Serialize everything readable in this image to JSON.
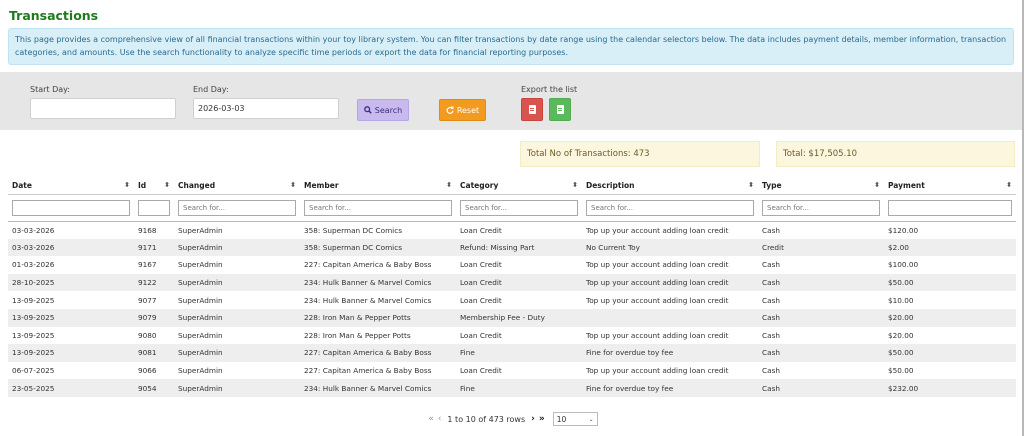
{
  "page": {
    "title": "Transactions",
    "info": "This page provides a comprehensive view of all financial transactions within your toy library system. You can filter transactions by date range using the calendar selectors below. The data includes payment details, member information, transaction categories, and amounts. Use the search functionality to analyze specific time periods or export the data for financial reporting purposes."
  },
  "filters": {
    "start_label": "Start Day:",
    "start_value": "",
    "end_label": "End Day:",
    "end_value": "2026-03-03",
    "search_label": "Search",
    "reset_label": "Reset",
    "export_label": "Export the list",
    "export_pdf_icon": "file-pdf-icon",
    "export_excel_icon": "file-excel-icon"
  },
  "summary": {
    "count_text": "Total No of Transactions: 473",
    "total_text": "Total: $17,505.10"
  },
  "table": {
    "columns": [
      "Date",
      "Id",
      "Changed",
      "Member",
      "Category",
      "Description",
      "Type",
      "Payment"
    ],
    "filter_placeholders": [
      "",
      "",
      "Search for...",
      "Search for...",
      "Search for...",
      "Search for...",
      "Search for...",
      ""
    ],
    "rows": [
      [
        "03-03-2026",
        "9168",
        "SuperAdmin",
        "358: Superman DC Comics",
        "Loan Credit",
        "Top up your account adding loan credit",
        "Cash",
        "$120.00"
      ],
      [
        "03-03-2026",
        "9171",
        "SuperAdmin",
        "358: Superman DC Comics",
        "Refund: Missing Part",
        "No Current Toy",
        "Credit",
        "$2.00"
      ],
      [
        "01-03-2026",
        "9167",
        "SuperAdmin",
        "227: Capitan America & Baby Boss",
        "Loan Credit",
        "Top up your account adding loan credit",
        "Cash",
        "$100.00"
      ],
      [
        "28-10-2025",
        "9122",
        "SuperAdmin",
        "234: Hulk Banner & Marvel Comics",
        "Loan Credit",
        "Top up your account adding loan credit",
        "Cash",
        "$50.00"
      ],
      [
        "13-09-2025",
        "9077",
        "SuperAdmin",
        "234: Hulk Banner & Marvel Comics",
        "Loan Credit",
        "Top up your account adding loan credit",
        "Cash",
        "$10.00"
      ],
      [
        "13-09-2025",
        "9079",
        "SuperAdmin",
        "228: Iron Man & Pepper Potts",
        "Membership Fee - Duty",
        "",
        "Cash",
        "$20.00"
      ],
      [
        "13-09-2025",
        "9080",
        "SuperAdmin",
        "228: Iron Man & Pepper Potts",
        "Loan Credit",
        "Top up your account adding loan credit",
        "Cash",
        "$20.00"
      ],
      [
        "13-09-2025",
        "9081",
        "SuperAdmin",
        "227: Capitan America & Baby Boss",
        "Fine",
        "Fine for overdue toy fee",
        "Cash",
        "$50.00"
      ],
      [
        "06-07-2025",
        "9066",
        "SuperAdmin",
        "227: Capitan America & Baby Boss",
        "Loan Credit",
        "Top up your account adding loan credit",
        "Cash",
        "$50.00"
      ],
      [
        "23-05-2025",
        "9054",
        "SuperAdmin",
        "234: Hulk Banner & Marvel Comics",
        "Fine",
        "Fine for overdue toy fee",
        "Cash",
        "$232.00"
      ]
    ]
  },
  "pagination": {
    "range_text": "1 to 10 of 473 rows",
    "page_size": "10"
  }
}
